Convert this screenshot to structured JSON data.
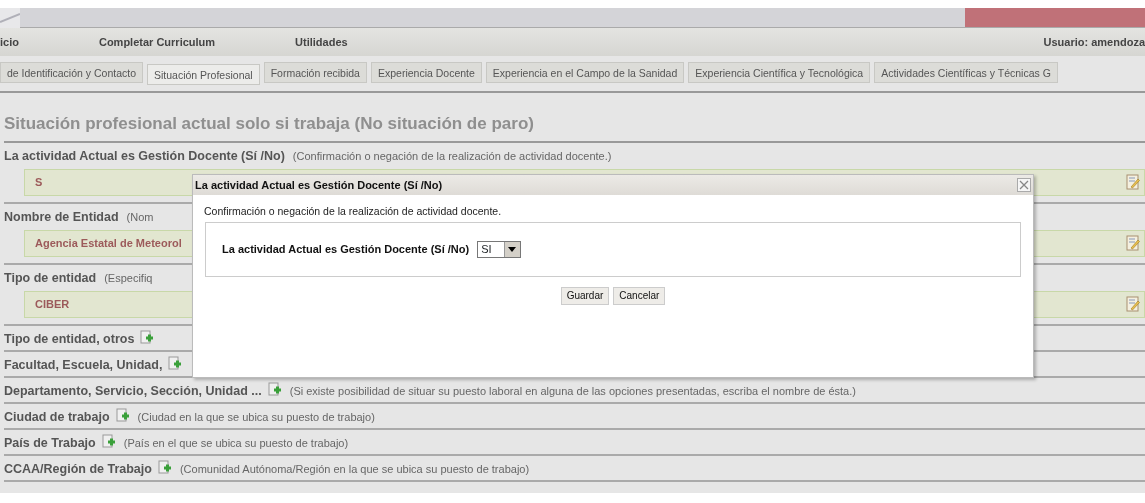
{
  "menu": {
    "items": [
      "icio",
      "Completar Curriculum",
      "Utilidades"
    ],
    "user": "Usuario: amendoza"
  },
  "tabs": [
    {
      "label": "de Identificación y Contacto",
      "selected": false
    },
    {
      "label": "Situación Profesional",
      "selected": true
    },
    {
      "label": "Formación recibida",
      "selected": false
    },
    {
      "label": "Experiencia Docente",
      "selected": false
    },
    {
      "label": "Experiencia en el Campo de la Sanidad",
      "selected": false
    },
    {
      "label": "Experiencia Científica y Tecnológica",
      "selected": false
    },
    {
      "label": "Actividades Científicas y Técnicas G",
      "selected": false
    }
  ],
  "heading": "Situación profesional actual solo si trabaja (No situación de paro)",
  "fields": [
    {
      "kind": "value",
      "label": "La actividad Actual es Gestión Docente (Sí /No)",
      "hint": "(Confirmación o negación de la realización de actividad docente.)",
      "value": "S"
    },
    {
      "kind": "value",
      "label": "Nombre de Entidad",
      "hint": "(Nom",
      "value": "Agencia Estatal de Meteorol"
    },
    {
      "kind": "value",
      "label": "Tipo de entidad",
      "hint": "(Especifiq",
      "value": "CIBER"
    },
    {
      "kind": "add",
      "label": "Tipo de entidad, otros"
    },
    {
      "kind": "add",
      "label": "Facultad, Escuela, Unidad,"
    },
    {
      "kind": "add",
      "label": "Departamento, Servicio, Sección, Unidad ...",
      "hint": "(Si existe posibilidad de situar su puesto laboral en alguna de las opciones presentadas, escriba el nombre de ésta.)"
    },
    {
      "kind": "add",
      "label": "Ciudad de trabajo",
      "hint": "(Ciudad en la que se ubica su puesto de trabajo)"
    },
    {
      "kind": "add",
      "label": "País de Trabajo",
      "hint": "(País en el que se ubica su puesto de trabajo)"
    },
    {
      "kind": "add",
      "label": "CCAA/Región de Trabajo",
      "hint": "(Comunidad Autónoma/Región en la que se ubica su puesto de trabajo)"
    }
  ],
  "dialog": {
    "title": "La actividad Actual es Gestión Docente (Sí /No)",
    "description": "Confirmación o negación de la realización de actividad docente.",
    "field_label": "La actividad Actual es Gestión Docente (Sí /No)",
    "select_value": "SI",
    "buttons": [
      "Guardar",
      "Cancelar"
    ]
  }
}
